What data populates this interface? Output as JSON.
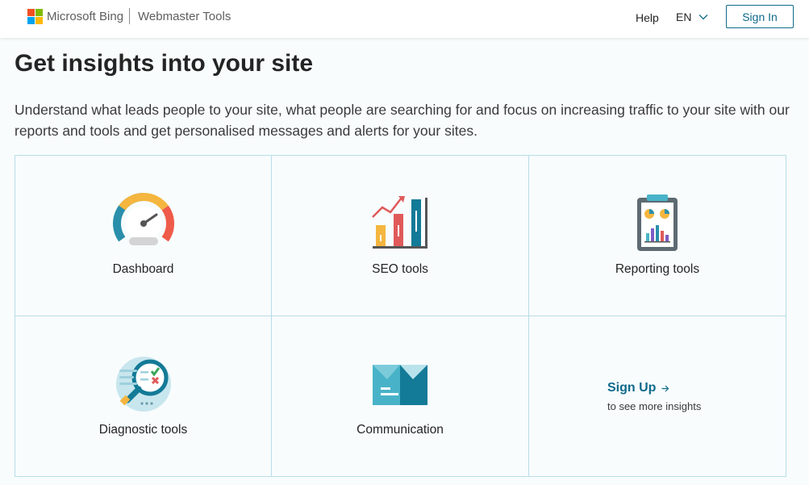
{
  "header": {
    "brand": "Microsoft Bing",
    "product": "Webmaster Tools",
    "help": "Help",
    "language": "EN",
    "sign_in": "Sign In"
  },
  "main": {
    "title": "Get insights into your site",
    "intro": "Understand what leads people to your site, what people are searching for and focus on increasing traffic to your site with our reports and tools and get personalised messages and alerts for your sites.",
    "tiles": [
      {
        "label": "Dashboard",
        "icon": "dashboard-gauge-icon"
      },
      {
        "label": "SEO tools",
        "icon": "seo-bar-chart-icon"
      },
      {
        "label": "Reporting tools",
        "icon": "clipboard-report-icon"
      },
      {
        "label": "Diagnostic tools",
        "icon": "magnifier-checklist-icon"
      },
      {
        "label": "Communication",
        "icon": "envelope-icon"
      }
    ],
    "signup": {
      "link": "Sign Up",
      "subtitle": "to see more insights"
    }
  },
  "colors": {
    "accent": "#0f6a8b",
    "tile_border": "#b7dde8",
    "background": "#f8fcfd"
  }
}
